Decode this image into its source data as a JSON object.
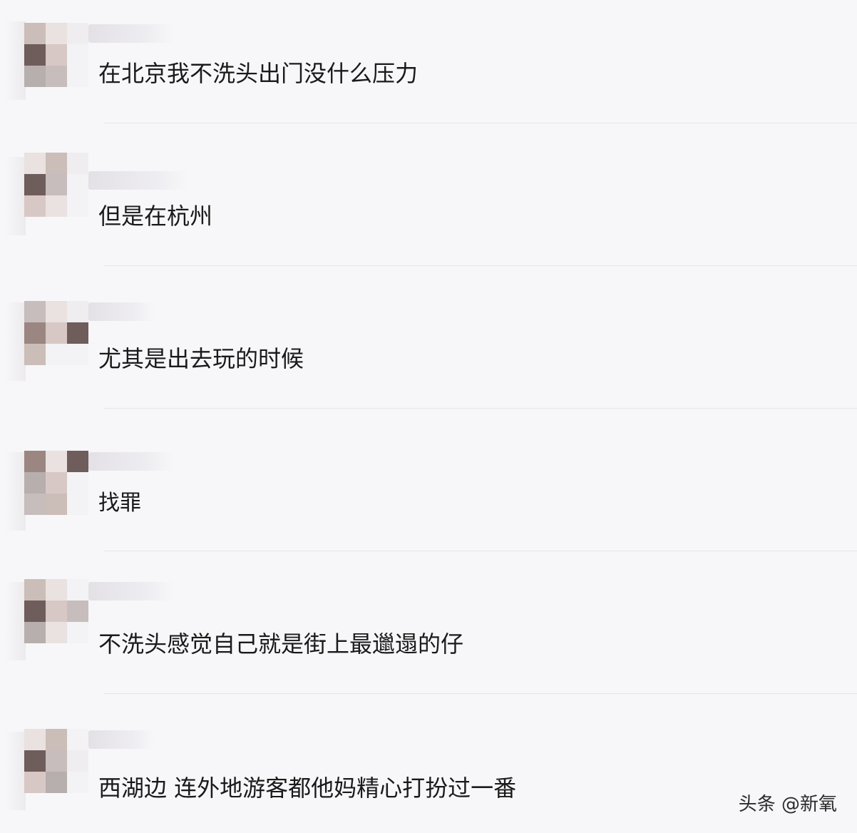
{
  "comments": [
    {
      "text": "在北京我不洗头出门没什么压力"
    },
    {
      "text": "但是在杭州"
    },
    {
      "text": "尤其是出去玩的时候"
    },
    {
      "text": "找罪"
    },
    {
      "text": "不洗头感觉自己就是街上最邋遢的仔"
    },
    {
      "text": "西湖边 连外地游客都他妈精心打扮过一番"
    }
  ],
  "watermark": "头条 @新氧"
}
